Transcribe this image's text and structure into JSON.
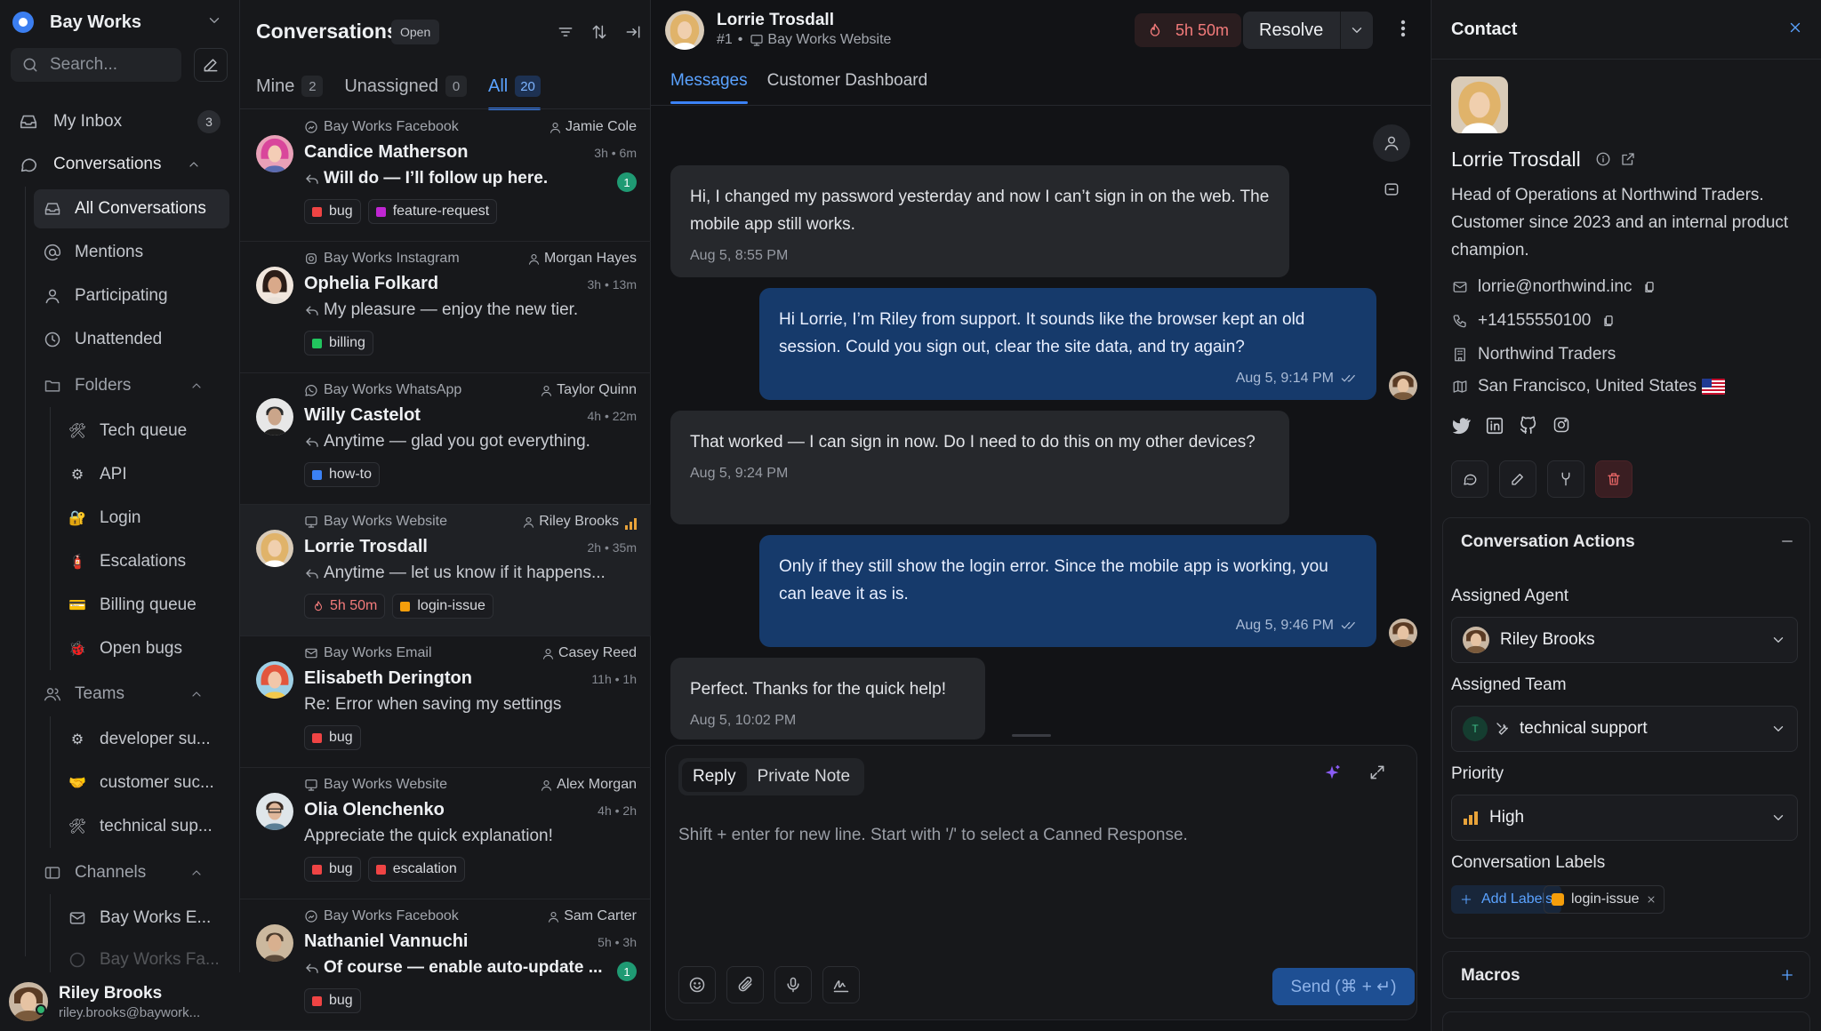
{
  "workspace": {
    "name": "Bay Works"
  },
  "sidebar": {
    "search_placeholder": "Search...",
    "my_inbox": {
      "label": "My Inbox",
      "count": "3"
    },
    "conversations": {
      "label": "Conversations"
    },
    "conv_items": [
      {
        "label": "All Conversations",
        "icon": "inbox-icon"
      },
      {
        "label": "Mentions",
        "icon": "at-icon"
      },
      {
        "label": "Participating",
        "icon": "user-icon"
      },
      {
        "label": "Unattended",
        "icon": "clock-icon"
      }
    ],
    "folders": {
      "label": "Folders",
      "items": [
        {
          "label": "Tech queue",
          "emoji": "🛠"
        },
        {
          "label": "API",
          "emoji": "⚙"
        },
        {
          "label": "Login",
          "emoji": "🔐"
        },
        {
          "label": "Escalations",
          "emoji": "🧯"
        },
        {
          "label": "Billing queue",
          "emoji": "💳"
        },
        {
          "label": "Open bugs",
          "emoji": "🐞"
        }
      ]
    },
    "teams": {
      "label": "Teams",
      "items": [
        {
          "label": "developer su...",
          "emoji": "⚙"
        },
        {
          "label": "customer suc...",
          "emoji": "🤝"
        },
        {
          "label": "technical sup...",
          "emoji": "🛠"
        }
      ]
    },
    "channels": {
      "label": "Channels",
      "items": [
        {
          "label": "Bay Works E..."
        },
        {
          "label": "Bay Works Fa..."
        }
      ]
    },
    "user": {
      "name": "Riley Brooks",
      "email": "riley.brooks@baywork..."
    }
  },
  "list": {
    "title": "Conversations",
    "status": "Open",
    "tabs": [
      {
        "label": "Mine",
        "count": "2"
      },
      {
        "label": "Unassigned",
        "count": "0"
      },
      {
        "label": "All",
        "count": "20"
      }
    ],
    "items": [
      {
        "channel": "Bay Works Facebook",
        "agent": "Jamie Cole",
        "name": "Candice Matherson",
        "time": "3h • 6m",
        "message": "Will do — I’ll follow up here.",
        "replied": true,
        "unread": "1",
        "labels": [
          {
            "text": "bug",
            "color": "#ef4444"
          },
          {
            "text": "feature-request",
            "color": "#c026d3"
          }
        ]
      },
      {
        "channel": "Bay Works Instagram",
        "agent": "Morgan Hayes",
        "name": "Ophelia Folkard",
        "time": "3h • 13m",
        "message": "My pleasure — enjoy the new tier.",
        "replied": true,
        "labels": [
          {
            "text": "billing",
            "color": "#22c55e"
          }
        ]
      },
      {
        "channel": "Bay Works WhatsApp",
        "agent": "Taylor Quinn",
        "name": "Willy Castelot",
        "time": "4h • 22m",
        "message": "Anytime — glad you got everything.",
        "replied": true,
        "labels": [
          {
            "text": "how-to",
            "color": "#3b82f6"
          }
        ]
      },
      {
        "channel": "Bay Works Website",
        "agent": "Riley Brooks",
        "name": "Lorrie Trosdall",
        "time": "2h • 35m",
        "message": "Anytime — let us know if it happens...",
        "replied": true,
        "sla": "5h 50m",
        "labels": [
          {
            "text": "login-issue",
            "color": "#f59e0b"
          }
        ]
      },
      {
        "channel": "Bay Works Email",
        "agent": "Casey Reed",
        "name": "Elisabeth Derington",
        "time": "11h • 1h",
        "message": "Re: Error when saving my settings",
        "replied": false,
        "labels": [
          {
            "text": "bug",
            "color": "#ef4444"
          }
        ]
      },
      {
        "channel": "Bay Works Website",
        "agent": "Alex Morgan",
        "name": "Olia Olenchenko",
        "time": "4h • 2h",
        "message": "Appreciate the quick explanation!",
        "replied": false,
        "labels": [
          {
            "text": "bug",
            "color": "#ef4444"
          },
          {
            "text": "escalation",
            "color": "#ef4444"
          }
        ]
      },
      {
        "channel": "Bay Works Facebook",
        "agent": "Sam Carter",
        "name": "Nathaniel Vannuchi",
        "time": "5h • 3h",
        "message": "Of course — enable auto-update ...",
        "replied": true,
        "unread": "1",
        "labels": [
          {
            "text": "bug",
            "color": "#ef4444"
          }
        ]
      }
    ]
  },
  "header": {
    "name": "Lorrie Trosdall",
    "id": "#1",
    "inbox": "Bay Works Website",
    "sla": "5h 50m",
    "resolve_label": "Resolve"
  },
  "main_tabs": [
    "Messages",
    "Customer Dashboard"
  ],
  "messages": [
    {
      "direction": "in",
      "text": "Hi, I changed my password yesterday and now I can’t sign in on the web. The mobile app still works.",
      "time": "Aug 5, 8:55 PM"
    },
    {
      "direction": "out",
      "text": "Hi Lorrie, I’m Riley from support. It sounds like the browser kept an old session. Could you sign out, clear the site data, and try again?",
      "time": "Aug 5, 9:14 PM"
    },
    {
      "direction": "in",
      "text": "That worked — I can sign in now. Do I need to do this on my other devices?",
      "time": "Aug 5, 9:24 PM"
    },
    {
      "direction": "out",
      "text": "Only if they still show the login error. Since the mobile app is working, you can leave it as is.",
      "time": "Aug 5, 9:46 PM"
    },
    {
      "direction": "in",
      "text": "Perfect. Thanks for the quick help!",
      "time": "Aug 5, 10:02 PM"
    }
  ],
  "composer": {
    "tabs": [
      "Reply",
      "Private Note"
    ],
    "placeholder": "Shift + enter for new line. Start with '/' to select a Canned Response.",
    "send_label": "Send (⌘ + ↵)"
  },
  "contact": {
    "title": "Contact",
    "name": "Lorrie Trosdall",
    "bio": "Head of Operations at Northwind Traders. Customer since 2023 and an internal product champion.",
    "email": "lorrie@northwind.inc",
    "phone": "+14155550100",
    "company": "Northwind Traders",
    "location": "San Francisco, United States",
    "actions_title": "Conversation Actions",
    "assigned_agent_label": "Assigned Agent",
    "assigned_agent": "Riley Brooks",
    "assigned_team_label": "Assigned Team",
    "team_initial": "T",
    "assigned_team": "technical support",
    "priority_label": "Priority",
    "priority": "High",
    "labels_title": "Conversation Labels",
    "add_labels": "Add Labels",
    "label": "login-issue",
    "macros_title": "Macros"
  },
  "colors": {
    "accent": "#3b82f6",
    "outgoing_bubble": "#163a6b",
    "sla": "#f37b7b",
    "priority": "#e8a33a"
  }
}
